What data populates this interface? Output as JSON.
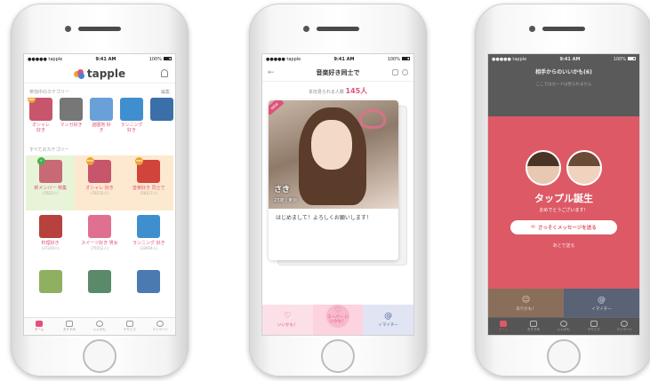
{
  "status_bar": {
    "carrier": "tapple",
    "time": "9:41 AM",
    "battery": "100%"
  },
  "screen1": {
    "logo_text": "tapple",
    "joined_label": "参加中のカテゴリー",
    "edit_label": "編集",
    "joined_categories": [
      {
        "name": "オシャレ 好き",
        "color": "#c7566c",
        "badge": "HOT",
        "badge_color": "#f0a030"
      },
      {
        "name": "マンガ好き",
        "color": "#777777"
      },
      {
        "name": "遊園地 好き",
        "color": "#6aa0d8"
      },
      {
        "name": "ランニング 好き",
        "color": "#3f8fcf"
      },
      {
        "name": "",
        "color": "#3a6fa8"
      }
    ],
    "all_label": "すべてのカテゴリー",
    "all_categories": [
      {
        "name": "新メンバー 特集",
        "count": "(7622人)",
        "color": "#c76a76",
        "badge": "f",
        "badge_color": "#4caf50",
        "bg": "#e8f4d8"
      },
      {
        "name": "オシャレ 好き",
        "count": "(78232人)",
        "color": "#c7566c",
        "badge": "HOT",
        "badge_color": "#f0a030",
        "bg": "#fde9cf"
      },
      {
        "name": "音楽好き 同士で",
        "count": "(58117人)",
        "color": "#d0443c",
        "badge": "HOT",
        "badge_color": "#f0a030",
        "bg": "#fde9cf"
      },
      {
        "name": "料理好き",
        "count": "(37220人)",
        "color": "#b7413c",
        "bg": "#ffffff"
      },
      {
        "name": "スイーツ好き 男女",
        "count": "(75552人)",
        "color": "#e07090",
        "bg": "#ffffff"
      },
      {
        "name": "ランニング 好き",
        "count": "(33954人)",
        "color": "#3f8fcf",
        "bg": "#ffffff"
      },
      {
        "name": "",
        "count": "",
        "color": "#8fb060",
        "bg": "#ffffff"
      },
      {
        "name": "",
        "count": "",
        "color": "#5a8a6a",
        "bg": "#ffffff"
      },
      {
        "name": "",
        "count": "",
        "color": "#4a7ab0",
        "bg": "#ffffff"
      }
    ],
    "tabs": [
      "ホーム",
      "おすすめ",
      "いいかも",
      "やりとり",
      "マイページ"
    ]
  },
  "screen2": {
    "title": "音楽好き同士で",
    "today_label": "本日見られる人数",
    "today_count": "145人",
    "new_label": "NEW",
    "profile_name": "さき",
    "profile_info": "23歳 | 東京",
    "message": "はじめまして！よろしくお願いします！",
    "like_label": "いいかも！",
    "super_label": "スーパー いいかも！",
    "imai_label": "イマイチー"
  },
  "screen3": {
    "title": "相手からのいいかも(6)",
    "note": "ここではカードは見られません",
    "match_title": "タップル誕生",
    "match_sub": "おめでとうございます！",
    "send_label": "さっそくメッセージを送る",
    "later_label": "あとで送る",
    "like_label": "ありかも！",
    "imai_label": "イマイチー"
  }
}
